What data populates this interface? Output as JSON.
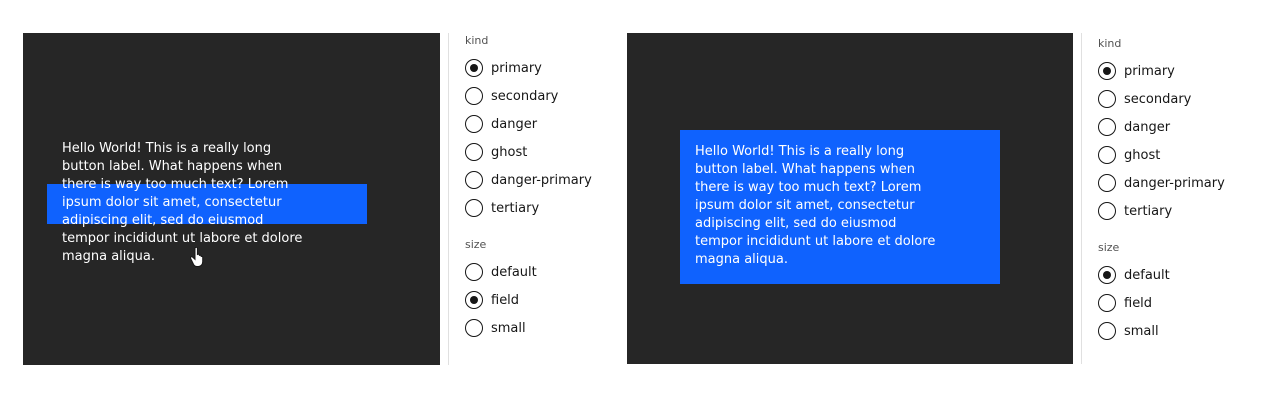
{
  "button_text": "Hello World! This is a really long\nbutton label. What happens when\nthere is way too much text? Lorem\nipsum dolor sit amet, consectetur\nadipiscing elit, sed do eiusmod\ntempor incididunt ut labore et dolore\nmagna aliqua.",
  "colors": {
    "stage": "#262626",
    "button": "#0f62fe",
    "divider": "#e0e0e0"
  },
  "left": {
    "kind_label": "kind",
    "kind_options": [
      "primary",
      "secondary",
      "danger",
      "ghost",
      "danger-primary",
      "tertiary"
    ],
    "kind_selected": "primary",
    "size_label": "size",
    "size_options": [
      "default",
      "field",
      "small"
    ],
    "size_selected": "field"
  },
  "right": {
    "kind_label": "kind",
    "kind_options": [
      "primary",
      "secondary",
      "danger",
      "ghost",
      "danger-primary",
      "tertiary"
    ],
    "kind_selected": "primary",
    "size_label": "size",
    "size_options": [
      "default",
      "field",
      "small"
    ],
    "size_selected": "default"
  }
}
